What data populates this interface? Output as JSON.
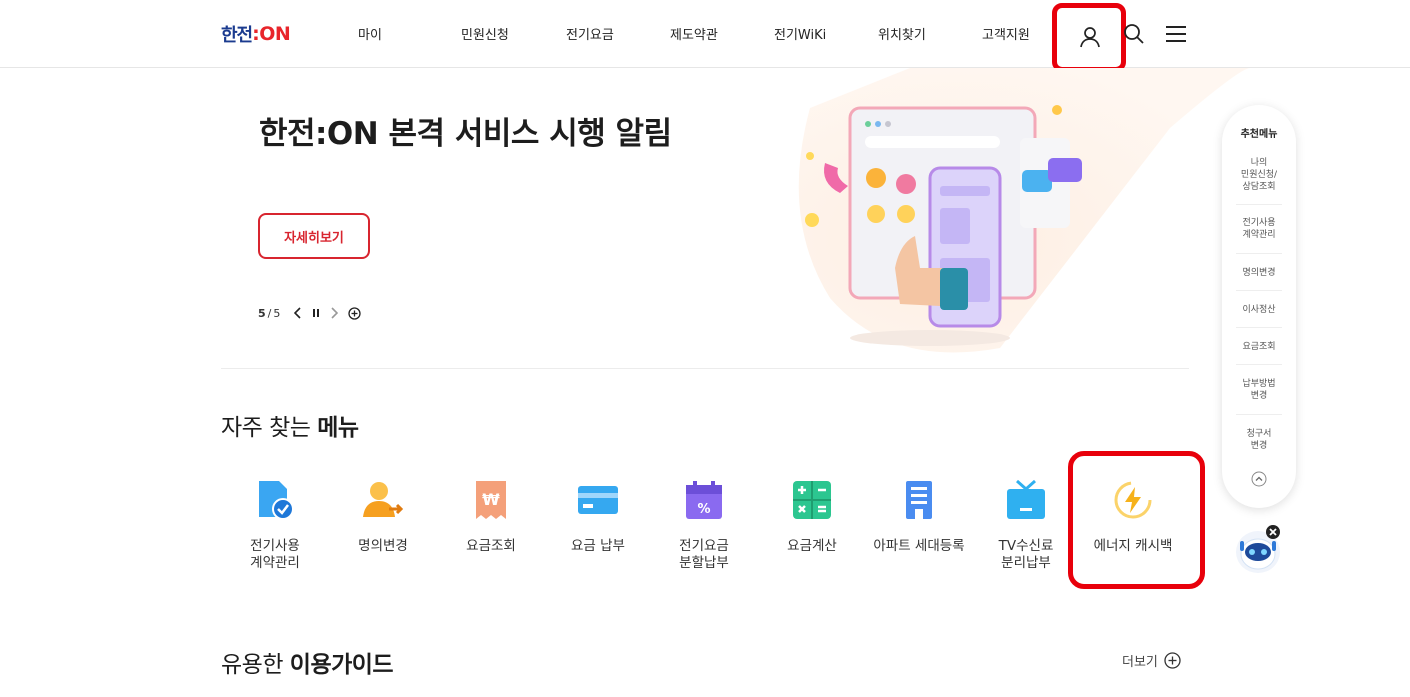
{
  "header": {
    "logo_text": "한전",
    "logo_on": ":ON",
    "nav": [
      "마이",
      "민원신청",
      "전기요금",
      "제도약관",
      "전기WiKi",
      "위치찾기",
      "고객지원"
    ]
  },
  "hero": {
    "title": "한전:ON 본격 서비스 시행 알림",
    "detail_button": "자세히보기",
    "pager_current": "5",
    "pager_sep": "/",
    "pager_total": "5"
  },
  "frequent": {
    "title_normal": "자주 찾는 ",
    "title_bold": "메뉴",
    "items": [
      {
        "label": "전기사용\n계약관리",
        "icon": "contract-document-icon",
        "color": "#3aa6f2"
      },
      {
        "label": "명의변경",
        "icon": "person-transfer-icon",
        "color": "#f6a020"
      },
      {
        "label": "요금조회",
        "icon": "won-receipt-icon",
        "color": "#f08a5a"
      },
      {
        "label": "요금 납부",
        "icon": "credit-card-icon",
        "color": "#35a8f0"
      },
      {
        "label": "전기요금\n분할납부",
        "icon": "calendar-percent-icon",
        "color": "#8a6af0"
      },
      {
        "label": "요금계산",
        "icon": "calculator-icon",
        "color": "#2cc690"
      },
      {
        "label": "아파트 세대등록",
        "icon": "apartment-building-icon",
        "color": "#4a8cf0"
      },
      {
        "label": "TV수신료\n분리납부",
        "icon": "tv-icon",
        "color": "#2fb0f0"
      },
      {
        "label": "에너지 캐시백",
        "icon": "energy-bolt-icon",
        "color": "#f6b21b"
      }
    ]
  },
  "guide": {
    "title_normal": "유용한 ",
    "title_bold": "이용가이드",
    "more": "더보기"
  },
  "side_menu": {
    "title": "추천메뉴",
    "items": [
      "나의\n민원신청/\n상담조회",
      "전기사용\n계약관리",
      "명의변경",
      "이사정산",
      "요금조회",
      "납부방법\n변경",
      "청구서\n변경"
    ]
  },
  "colors": {
    "brand_red": "#e8252b",
    "brand_navy": "#1b3b8f",
    "highlight_red": "#e8000b"
  }
}
